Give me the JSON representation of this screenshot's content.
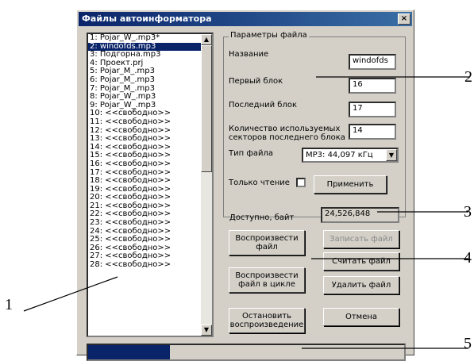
{
  "window": {
    "title": "Файлы автоинформатора",
    "close_glyph": "×"
  },
  "file_list": {
    "items": [
      "1: Pojar_W_.mp3*",
      "2: windofds.mp3",
      "3: Подгорна.mp3",
      "4: Проект.prj",
      "5: Pojar_M_.mp3",
      "6: Pojar_M_.mp3",
      "7: Pojar_M_.mp3",
      "8: Pojar_W_.mp3",
      "9: Pojar_W_.mp3",
      "10: <<свободно>>",
      "11: <<свободно>>",
      "12: <<свободно>>",
      "13: <<свободно>>",
      "14: <<свободно>>",
      "15: <<свободно>>",
      "16: <<свободно>>",
      "17: <<свободно>>",
      "18: <<свободно>>",
      "19: <<свободно>>",
      "20: <<свободно>>",
      "21: <<свободно>>",
      "22: <<свободно>>",
      "23: <<свободно>>",
      "24: <<свободно>>",
      "25: <<свободно>>",
      "26: <<свободно>>",
      "27: <<свободно>>",
      "28: <<свободно>>"
    ],
    "selected_index": 1
  },
  "params": {
    "group_title": "Параметры файла",
    "name_label": "Название",
    "name_value": "windofds",
    "first_block_label": "Первый блок",
    "first_block_value": "16",
    "last_block_label": "Последний блок",
    "last_block_value": "17",
    "sectors_label_line1": "Количество используемых",
    "sectors_label_line2": "секторов последнего блока",
    "sectors_value": "14",
    "type_label": "Тип файла",
    "type_value": "MP3: 44,097 кГц",
    "readonly_label": "Только чтение",
    "apply_button": "Применить"
  },
  "available": {
    "label": "Доступно, байт",
    "value": "24,526,848"
  },
  "buttons": {
    "play": "Воспроизвести файл",
    "play_loop": "Воспроизвести файл в цикле",
    "stop": "Остановить воспроизведение",
    "write": "Записать файл",
    "read": "Считать файл",
    "delete": "Удалить файл",
    "cancel": "Отмена"
  },
  "progress": {
    "fraction": 0.26
  },
  "callouts": {
    "c1": "1",
    "c2": "2",
    "c3": "3",
    "c4": "4",
    "c5": "5"
  },
  "icons": {
    "scroll_up": "▲",
    "scroll_down": "▼",
    "combo_arrow": "▼"
  }
}
